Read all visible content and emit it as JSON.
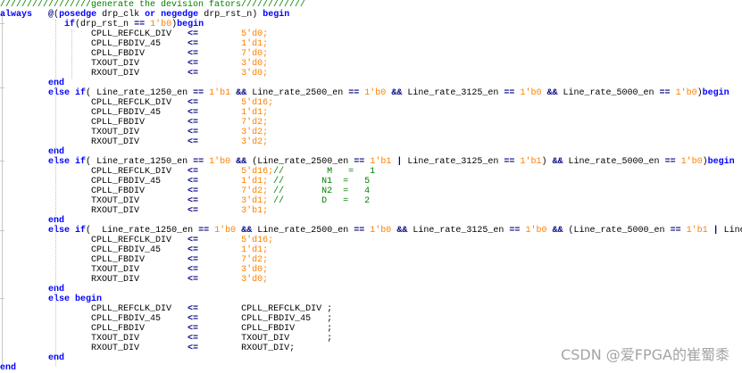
{
  "code": {
    "comment_line": "/////////////////generate the devision fators////////////",
    "lines": [
      {
        "text": "always",
        "cls": "kw"
      },
      {
        "text": "@(posedge drp_clk or negedge drp_rst_n) begin"
      },
      {
        "text": "if(drp_rst_n == 1'b0)begin"
      },
      {
        "text": "CPLL_REFCLK_DIV <= 5'd0;"
      },
      {
        "text": "CPLL_FBDIV_45 <= 1'd1;"
      },
      {
        "text": "CPLL_FBDIV <= 7'd0;"
      },
      {
        "text": "TXOUT_DIV <= 3'd0;"
      },
      {
        "text": "RXOUT_DIV <= 3'd0;"
      },
      {
        "text": "end"
      },
      {
        "text": "else if( Line_rate_1250_en == 1'b1 && Line_rate_2500_en == 1'b0 && Line_rate_3125_en == 1'b0 && Line_rate_5000_en == 1'b0)begin"
      },
      {
        "text": "else if( Line_rate_1250_en == 1'b0 && (Line_rate_2500_en == 1'b1 | Line_rate_3125_en == 1'b1) && Line_rate_5000_en == 1'b0)begin"
      },
      {
        "text": "else if(  Line_rate_1250_en == 1'b0 && Line_rate_2500_en == 1'b0 && Line_rate_3125_en == 1'b0 && (Line_rate_5000_en == 1'b1 | Line_"
      },
      {
        "text": "else begin"
      }
    ],
    "assign_op": "<=",
    "blocks": [
      {
        "rows": [
          {
            "sig": "CPLL_REFCLK_DIV",
            "val": "5'd0",
            "end": ";",
            "note": ""
          },
          {
            "sig": "CPLL_FBDIV_45",
            "val": "1'd1",
            "end": ";",
            "note": ""
          },
          {
            "sig": "CPLL_FBDIV",
            "val": "7'd0",
            "end": ";",
            "note": ""
          },
          {
            "sig": "TXOUT_DIV",
            "val": "3'd0",
            "end": ";",
            "note": ""
          },
          {
            "sig": "RXOUT_DIV",
            "val": "3'd0",
            "end": ";",
            "note": ""
          }
        ]
      },
      {
        "rows": [
          {
            "sig": "CPLL_REFCLK_DIV",
            "val": "5'd16",
            "end": ";",
            "note": ""
          },
          {
            "sig": "CPLL_FBDIV_45",
            "val": "1'd1",
            "end": ";",
            "note": ""
          },
          {
            "sig": "CPLL_FBDIV",
            "val": "7'd2",
            "end": ";",
            "note": ""
          },
          {
            "sig": "TXOUT_DIV",
            "val": "3'd2",
            "end": ";",
            "note": ""
          },
          {
            "sig": "RXOUT_DIV",
            "val": "3'd2",
            "end": ";",
            "note": ""
          }
        ]
      },
      {
        "rows": [
          {
            "sig": "CPLL_REFCLK_DIV",
            "val": "5'd16",
            "end": ";",
            "note": "//        M   =   1"
          },
          {
            "sig": "CPLL_FBDIV_45",
            "val": "1'd1",
            "end": ";",
            "note": " //       N1  =   5"
          },
          {
            "sig": "CPLL_FBDIV",
            "val": "7'd2",
            "end": ";",
            "note": " //       N2  =   4"
          },
          {
            "sig": "TXOUT_DIV",
            "val": "3'd1",
            "end": ";",
            "note": " //       D   =   2"
          },
          {
            "sig": "RXOUT_DIV",
            "val": "3'b1",
            "end": ";",
            "note": ""
          }
        ]
      },
      {
        "rows": [
          {
            "sig": "CPLL_REFCLK_DIV",
            "val": "5'd16",
            "end": ";",
            "note": ""
          },
          {
            "sig": "CPLL_FBDIV_45",
            "val": "1'd1",
            "end": ";",
            "note": ""
          },
          {
            "sig": "CPLL_FBDIV",
            "val": "7'd2",
            "end": ";",
            "note": ""
          },
          {
            "sig": "TXOUT_DIV",
            "val": "3'd0",
            "end": ";",
            "note": ""
          },
          {
            "sig": "RXOUT_DIV",
            "val": "3'd0",
            "end": ";",
            "note": ""
          }
        ]
      },
      {
        "rows": [
          {
            "sig": "CPLL_REFCLK_DIV",
            "val": "CPLL_REFCLK_DIV",
            "end": " ;",
            "note": ""
          },
          {
            "sig": "CPLL_FBDIV_45",
            "val": "CPLL_FBDIV_45",
            "end": "   ;",
            "note": ""
          },
          {
            "sig": "CPLL_FBDIV",
            "val": "CPLL_FBDIV",
            "end": "      ;",
            "note": ""
          },
          {
            "sig": "TXOUT_DIV",
            "val": "TXOUT_DIV",
            "end": "       ;",
            "note": ""
          },
          {
            "sig": "RXOUT_DIV",
            "val": "RXOUT_DIV",
            "end": ";",
            "note": ""
          }
        ]
      }
    ],
    "end_kw": "end",
    "begin_kw": "begin"
  },
  "watermark": "CSDN @爱FPGA的崔蜀黍"
}
